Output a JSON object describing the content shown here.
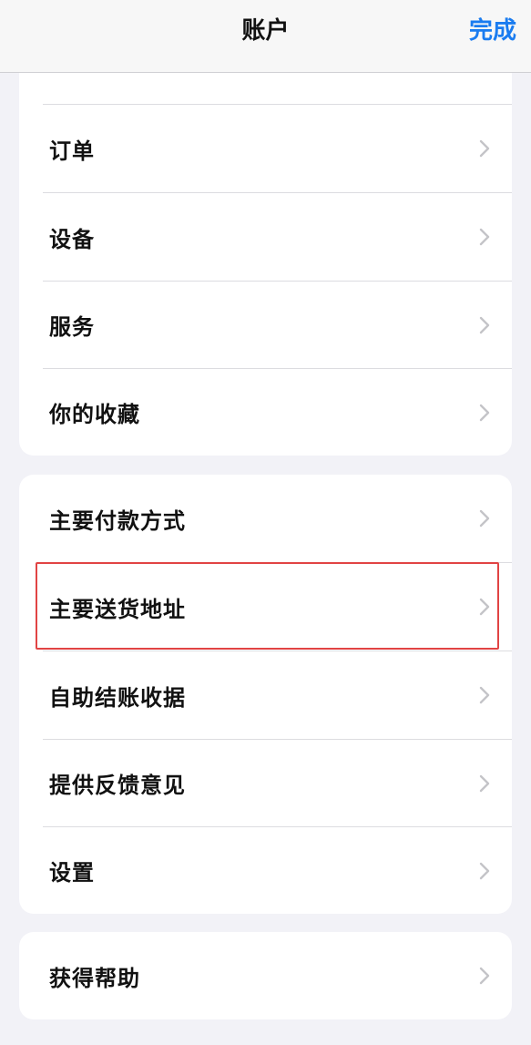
{
  "header": {
    "title": "账户",
    "done_label": "完成"
  },
  "section1": {
    "items": [
      "订单",
      "设备",
      "服务",
      "你的收藏"
    ]
  },
  "section2": {
    "items": [
      "主要付款方式",
      "主要送货地址",
      "自助结账收据",
      "提供反馈意见",
      "设置"
    ]
  },
  "section3": {
    "items": [
      "获得帮助"
    ]
  },
  "icons": {
    "row_chevron": "chevron-right-icon"
  },
  "colors": {
    "accent": "#1a7cf0",
    "highlight_border": "#e14444",
    "background": "#f2f2f7"
  }
}
